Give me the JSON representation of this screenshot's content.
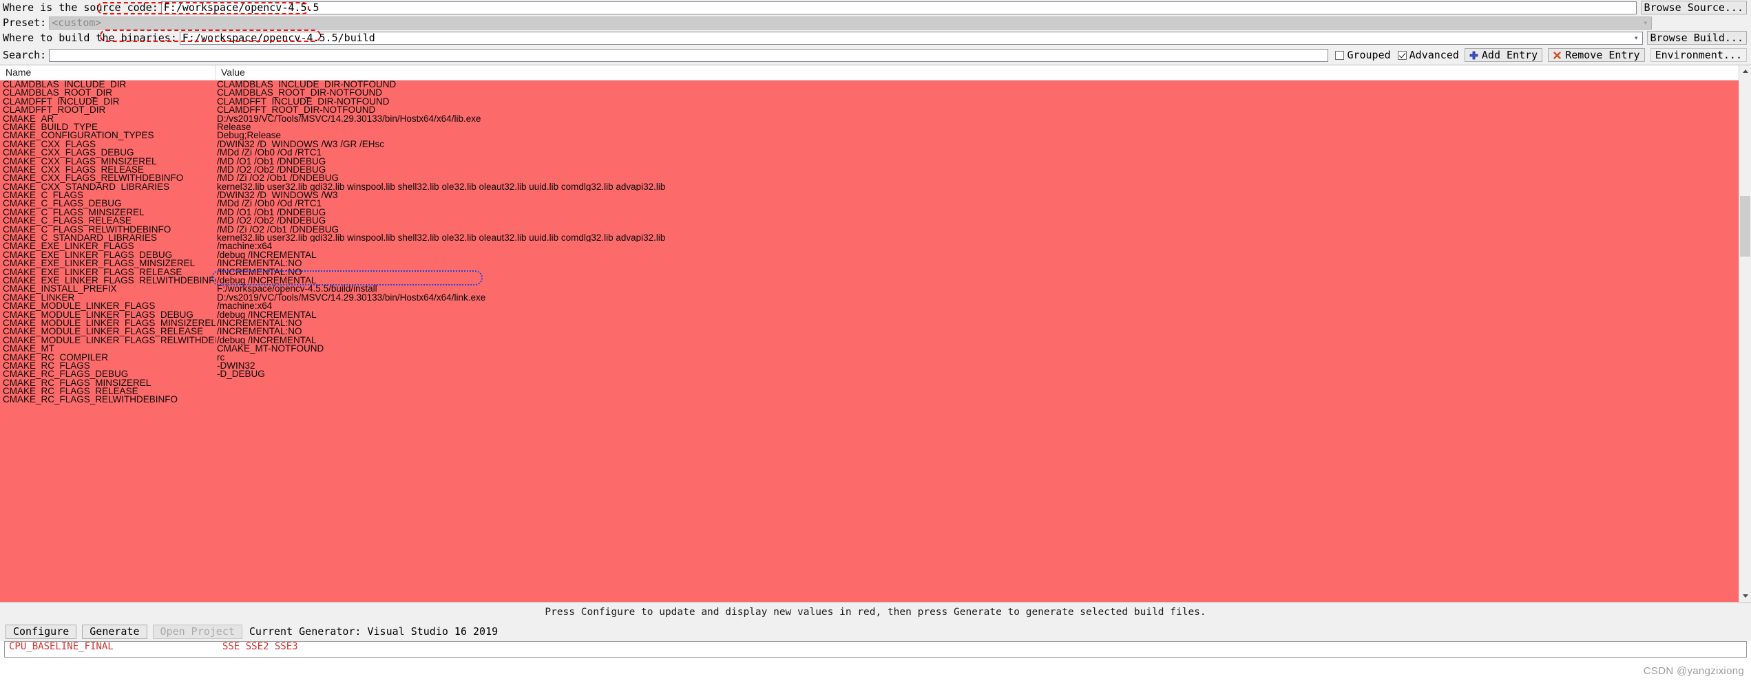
{
  "form": {
    "source_label": "Where is the source code:",
    "source_value": "F:/workspace/opencv-4.5.5",
    "browse_source_label": "Browse Source...",
    "preset_label": "Preset:",
    "preset_value": "<custom>",
    "build_label": "Where to build the binaries:",
    "build_value": "F:/workspace/opencv-4.5.5/build",
    "browse_build_label": "Browse Build..."
  },
  "search": {
    "label": "Search:",
    "value": "",
    "placeholder": "",
    "grouped_label": "Grouped",
    "grouped_checked": false,
    "advanced_label": "Advanced",
    "advanced_checked": true,
    "add_entry_label": "Add Entry",
    "remove_entry_label": "Remove Entry",
    "environment_label": "Environment..."
  },
  "table": {
    "col_name": "Name",
    "col_value": "Value",
    "rows": [
      {
        "name": "CLAMDBLAS_INCLUDE_DIR",
        "value": "CLAMDBLAS_INCLUDE_DIR-NOTFOUND"
      },
      {
        "name": "CLAMDBLAS_ROOT_DIR",
        "value": "CLAMDBLAS_ROOT_DIR-NOTFOUND"
      },
      {
        "name": "CLAMDFFT_INCLUDE_DIR",
        "value": "CLAMDFFT_INCLUDE_DIR-NOTFOUND"
      },
      {
        "name": "CLAMDFFT_ROOT_DIR",
        "value": "CLAMDFFT_ROOT_DIR-NOTFOUND"
      },
      {
        "name": "CMAKE_AR",
        "value": "D:/vs2019/VC/Tools/MSVC/14.29.30133/bin/Hostx64/x64/lib.exe"
      },
      {
        "name": "CMAKE_BUILD_TYPE",
        "value": "Release"
      },
      {
        "name": "CMAKE_CONFIGURATION_TYPES",
        "value": "Debug;Release"
      },
      {
        "name": "CMAKE_CXX_FLAGS",
        "value": "/DWIN32 /D_WINDOWS /W3 /GR /EHsc"
      },
      {
        "name": "CMAKE_CXX_FLAGS_DEBUG",
        "value": "/MDd /Zi /Ob0 /Od /RTC1"
      },
      {
        "name": "CMAKE_CXX_FLAGS_MINSIZEREL",
        "value": "/MD /O1 /Ob1 /DNDEBUG"
      },
      {
        "name": "CMAKE_CXX_FLAGS_RELEASE",
        "value": "/MD /O2 /Ob2 /DNDEBUG"
      },
      {
        "name": "CMAKE_CXX_FLAGS_RELWITHDEBINFO",
        "value": "/MD /Zi /O2 /Ob1 /DNDEBUG"
      },
      {
        "name": "CMAKE_CXX_STANDARD_LIBRARIES",
        "value": "kernel32.lib user32.lib gdi32.lib winspool.lib shell32.lib ole32.lib oleaut32.lib uuid.lib comdlg32.lib advapi32.lib"
      },
      {
        "name": "CMAKE_C_FLAGS",
        "value": "/DWIN32 /D_WINDOWS /W3"
      },
      {
        "name": "CMAKE_C_FLAGS_DEBUG",
        "value": "/MDd /Zi /Ob0 /Od /RTC1"
      },
      {
        "name": "CMAKE_C_FLAGS_MINSIZEREL",
        "value": "/MD /O1 /Ob1 /DNDEBUG"
      },
      {
        "name": "CMAKE_C_FLAGS_RELEASE",
        "value": "/MD /O2 /Ob2 /DNDEBUG"
      },
      {
        "name": "CMAKE_C_FLAGS_RELWITHDEBINFO",
        "value": "/MD /Zi /O2 /Ob1 /DNDEBUG"
      },
      {
        "name": "CMAKE_C_STANDARD_LIBRARIES",
        "value": "kernel32.lib user32.lib gdi32.lib winspool.lib shell32.lib ole32.lib oleaut32.lib uuid.lib comdlg32.lib advapi32.lib"
      },
      {
        "name": "CMAKE_EXE_LINKER_FLAGS",
        "value": "/machine:x64"
      },
      {
        "name": "CMAKE_EXE_LINKER_FLAGS_DEBUG",
        "value": "/debug /INCREMENTAL"
      },
      {
        "name": "CMAKE_EXE_LINKER_FLAGS_MINSIZEREL",
        "value": "/INCREMENTAL:NO"
      },
      {
        "name": "CMAKE_EXE_LINKER_FLAGS_RELEASE",
        "value": "/INCREMENTAL:NO"
      },
      {
        "name": "CMAKE_EXE_LINKER_FLAGS_RELWITHDEBINFO",
        "value": "/debug /INCREMENTAL"
      },
      {
        "name": "CMAKE_INSTALL_PREFIX",
        "value": "F:/workspace/opencv-4.5.5/build/install"
      },
      {
        "name": "CMAKE_LINKER",
        "value": "D:/vs2019/VC/Tools/MSVC/14.29.30133/bin/Hostx64/x64/link.exe"
      },
      {
        "name": "CMAKE_MODULE_LINKER_FLAGS",
        "value": "/machine:x64"
      },
      {
        "name": "CMAKE_MODULE_LINKER_FLAGS_DEBUG",
        "value": "/debug /INCREMENTAL"
      },
      {
        "name": "CMAKE_MODULE_LINKER_FLAGS_MINSIZEREL",
        "value": "/INCREMENTAL:NO"
      },
      {
        "name": "CMAKE_MODULE_LINKER_FLAGS_RELEASE",
        "value": "/INCREMENTAL:NO"
      },
      {
        "name": "CMAKE_MODULE_LINKER_FLAGS_RELWITHDEBINFO",
        "value": "/debug /INCREMENTAL"
      },
      {
        "name": "CMAKE_MT",
        "value": "CMAKE_MT-NOTFOUND"
      },
      {
        "name": "CMAKE_RC_COMPILER",
        "value": "rc"
      },
      {
        "name": "CMAKE_RC_FLAGS",
        "value": "-DWIN32"
      },
      {
        "name": "CMAKE_RC_FLAGS_DEBUG",
        "value": "-D_DEBUG"
      },
      {
        "name": "CMAKE_RC_FLAGS_MINSIZEREL",
        "value": ""
      },
      {
        "name": "CMAKE_RC_FLAGS_RELEASE",
        "value": ""
      },
      {
        "name": "CMAKE_RC_FLAGS_RELWITHDEBINFO",
        "value": ""
      }
    ]
  },
  "status": {
    "message": "Press Configure to update and display new values in red, then press Generate to generate selected build files."
  },
  "bottom": {
    "configure_label": "Configure",
    "generate_label": "Generate",
    "open_project_label": "Open Project",
    "generator_text": "Current Generator: Visual Studio 16 2019"
  },
  "log": {
    "rows": [
      {
        "key": "CPU_BASELINE_FINAL",
        "value": "SSE SSE2 SSE3"
      }
    ]
  },
  "watermark": {
    "text": "CSDN @yangzixiong"
  },
  "colors": {
    "modified_row_bg": "#fd6a6a",
    "annotation_red": "#ee1111",
    "annotation_blue": "#1745e8",
    "window_bg": "#f0f0f0"
  }
}
